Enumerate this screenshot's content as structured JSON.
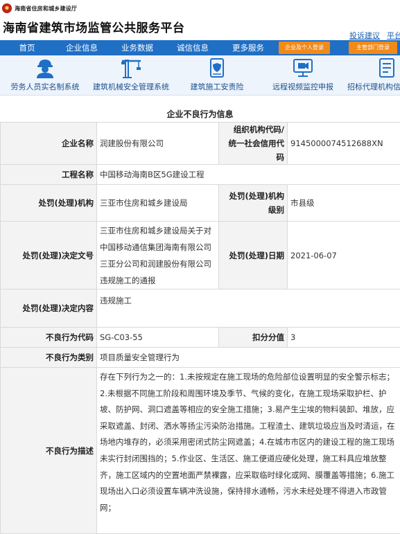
{
  "header": {
    "org_name": "海南省住房和城乡建设厅",
    "site_title": "海南省建筑市场监管公共服务平台",
    "links": [
      "投诉建议",
      "平台用"
    ]
  },
  "nav": {
    "items": [
      "首页",
      "企业信息",
      "业务数据",
      "诚信信息",
      "更多服务"
    ],
    "login_company": "企业及个人登录",
    "login_gov": "主管部门登录",
    "accent": "#1f6fc5",
    "login_color": "#f08a1a"
  },
  "systems": [
    {
      "label": "劳务人员实名制系统",
      "icon": "worker-icon"
    },
    {
      "label": "建筑机械安全管理系统",
      "icon": "crane-icon"
    },
    {
      "label": "建筑施工安责险",
      "icon": "insurance-document-icon"
    },
    {
      "label": "远程视频监控申报",
      "icon": "video-monitor-icon"
    },
    {
      "label": "招标代理机构信",
      "icon": "tender-document-icon"
    }
  ],
  "detail": {
    "title": "企业不良行为信息",
    "rows": {
      "company_label": "企业名称",
      "company_value": "润建股份有限公司",
      "credit_label_1": "组织机构代码/",
      "credit_label_2": "统一社会信用代码",
      "credit_value": "9145000074512688XN",
      "project_label": "工程名称",
      "project_value": "中国移动海南B区5G建设工程",
      "authority_label": "处罚(处理)机构",
      "authority_value": "三亚市住房和城乡建设局",
      "level_label": "处罚(处理)机构级别",
      "level_value": "市县级",
      "decision_doc_label": "处罚(处理)决定文号",
      "decision_doc_value": "三亚市住房和城乡建设局关于对中国移动通信集团海南有限公司三亚分公司和润建股份有限公司违规施工的通报",
      "date_label": "处罚(处理)日期",
      "date_value": "2021-06-07",
      "decision_content_label": "处罚(处理)决定内容",
      "decision_content_value": "违规施工",
      "code_label": "不良行为代码",
      "code_value": "SG-C03-55",
      "points_label": "扣分分值",
      "points_value": "3",
      "category_label": "不良行为类别",
      "category_value": "项目质量安全管理行为",
      "description_label": "不良行为描述",
      "description_value": "存在下列行为之一的：1.未按规定在施工现场的危险部位设置明显的安全警示标志；2.未根据不同施工阶段和周围环境及季节、气候的变化，在施工现场采取护栏、护坡、防护网、洞口遮盖等相应的安全施工措施；3.易产生尘埃的物料装卸、堆放，应采取遮盖、封闭、洒水等扬尘污染防治措施。工程渣土、建筑垃圾应当及时清运，在场地内堆存的，必须采用密闭式防尘网遮盖；4.在城市市区内的建设工程的施工现场未实行封闭围挡的；5.作业区、生活区、施工便道应硬化处理，施工料具应堆放整齐，施工区域内的空置地面严禁裸露，应采取临时绿化或网、膜覆盖等措施；6.施工现场出入口必须设置车辆冲洗设施，保持排水通畅，污水未经处理不得进入市政管网；"
    }
  }
}
